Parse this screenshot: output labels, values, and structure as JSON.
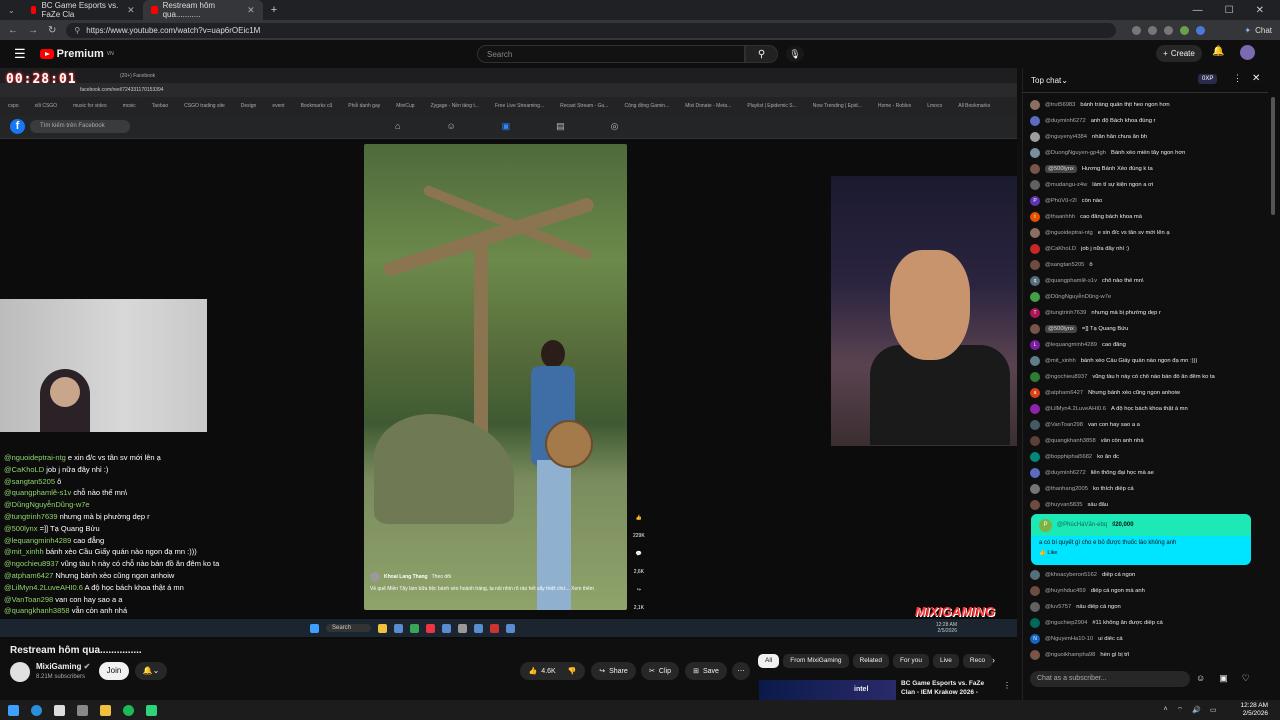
{
  "browser": {
    "tabs": [
      {
        "title": "BC Game Esports vs. FaZe Cla"
      },
      {
        "title": "Restream hôm qua..........."
      }
    ],
    "new_tab": "+",
    "url": "https://www.youtube.com/watch?v=uap6rOEic1M",
    "chat_button": "Chat"
  },
  "youtube": {
    "brand": "Premium",
    "region": "VN",
    "search_placeholder": "Search",
    "create_label": "Create"
  },
  "video": {
    "timer": "00:28:01",
    "inner_tab_fb": "(20+) Facebook",
    "inner_url": "facebook.com/reel/724331170153394",
    "bookmarks": [
      "cspo",
      "xổi CSGO",
      "music for video",
      "mosic",
      "Taobao",
      "CSGO trading site",
      "Design",
      "event",
      "Bookmarks cũ",
      "Phối danh gay",
      "MiniCup",
      "Zygage - Nền tảng t...",
      "Free Live Streaming...",
      "Recast Stream - Gu...",
      "Cộng đồng Gamin...",
      "Mixi Donate - Meta...",
      "Playlist | Epidemic S...",
      "Now Trending | Epid...",
      "Home - Roblox",
      "Lmoco",
      "All Bookmarks"
    ],
    "fb_search": "Tìm kiếm trên Facebook",
    "reel_author": "Khoai Lang Thang",
    "reel_follow": "Theo dõi",
    "reel_caption": "Về quê Miền Tây làm bữa tiệc bánh xèo hoành tráng, ta nói nhìn rõ ráo hết sẩy thiệt chứ... Xem thêm",
    "reel_likes": "229K",
    "reel_comments": "2,6K",
    "reel_shares": "2,1K",
    "overlay_chat": [
      {
        "user": "@nguoideptrai-ntg",
        "text": "e xin đ/c vs tân sv mới lên ạ"
      },
      {
        "user": "@CaKhoLD",
        "text": "job j nữa đây nhỉ :)"
      },
      {
        "user": "@sangtan5205",
        "text": "ô"
      },
      {
        "user": "@quangphamlê-s1v",
        "text": "chỗ nào thế mn\\"
      },
      {
        "user": "@DũngNguyễnDũng-w7e",
        "text": ""
      },
      {
        "user": "@tungtrinh7639",
        "text": "nhưng mà bị phường dẹp r"
      },
      {
        "user": "@500lynx",
        "text": "=]] Tạ Quang Bửu"
      },
      {
        "user": "@lequangminh4289",
        "text": "cao đẳng"
      },
      {
        "user": "@mit_xinhh",
        "text": "bánh xèo Cầu Giấy quán nào ngon đạ mn :)))"
      },
      {
        "user": "@ngochieu8937",
        "text": "vũng tàu h này có chỗ nào bán đồ ăn đêm ko ta"
      },
      {
        "user": "@atpham6427",
        "text": "Nhưng bánh xèo cũng ngon anhoiw"
      },
      {
        "user": "@LilMyn4.2LuveAHI0.6",
        "text": "A độ học bách khoa thật á mn"
      },
      {
        "user": "@VanToan298",
        "text": "van con hay sao a a"
      },
      {
        "user": "@quangkhanh3858",
        "text": "vẫn còn anh nhá"
      },
      {
        "user": "@bopphiphai5682",
        "text": "ko ăn đc"
      }
    ],
    "watermark": "MIXIGAMING",
    "taskbar_search": "Search",
    "taskbar_time": "12:28 AM",
    "taskbar_date": "2/5/2026",
    "title": "Restream hôm qua...............",
    "channel": "MixiGaming",
    "subscribers": "8.21M subscribers",
    "join": "Join",
    "likes": "4.6K",
    "share": "Share",
    "clip": "Clip",
    "save": "Save"
  },
  "chips": [
    "All",
    "From MixiGaming",
    "Related",
    "For you",
    "Live",
    "Reco"
  ],
  "recommended": {
    "title": "BC Game Esports vs. FaZe Clan - IEM Krakow 2026 -",
    "thumb_text": "intel"
  },
  "chat": {
    "header": "Top chat",
    "xp": "0XP",
    "messages": [
      {
        "user": "@trut56983",
        "text": "bánh tráng quấn thịt heo ngon hơn",
        "color": "#8d6e63",
        "initial": ""
      },
      {
        "user": "@duyminh6272",
        "text": "anh độ Bách khoa đúng r",
        "color": "#5c6bc0",
        "initial": ""
      },
      {
        "user": "@nguyenyi4384",
        "text": "nhắn hẳn chưa ăn bh",
        "color": "#9e9e9e",
        "initial": ""
      },
      {
        "user": "@DuongNguyen-gp4gh",
        "text": "Bánh xèo miền tây ngon hơn",
        "color": "#78909c",
        "initial": ""
      },
      {
        "user": "@500lynx",
        "text": "Hương Bánh Xèo đúng k ta",
        "color": "#795548",
        "initial": "",
        "mod": true
      },
      {
        "user": "@mudangu-z4w",
        "text": "làm tí sự kiện ngon a ơi",
        "color": "#616161",
        "initial": ""
      },
      {
        "user": "@PhúVũ-r2l",
        "text": "còn nào",
        "color": "#5e35b1",
        "initial": "P"
      },
      {
        "user": "@thaanhhh",
        "text": "cao đẳng bách khoa mà",
        "color": "#e65100",
        "initial": "t"
      },
      {
        "user": "@nguoideptrai-ntg",
        "text": "e xin đ/c vs tân sv mới lên ạ",
        "color": "#8d6e63",
        "initial": ""
      },
      {
        "user": "@CaKhoLD",
        "text": "job j nữa đây nhỉ :)",
        "color": "#c62828",
        "initial": ""
      },
      {
        "user": "@sangtan5205",
        "text": "ô",
        "color": "#6d4c41",
        "initial": ""
      },
      {
        "user": "@quangphamlê-s1v",
        "text": "chỗ nào thế mn\\",
        "color": "#546e7a",
        "initial": "q"
      },
      {
        "user": "@DũngNguyễnDũng-w7e",
        "text": "",
        "color": "#43a047",
        "initial": ""
      },
      {
        "user": "@tungtrinh7639",
        "text": "nhưng mà bị phường dẹp r",
        "color": "#ad1457",
        "initial": "T"
      },
      {
        "user": "@500lynx",
        "text": "=]] Tạ Quang Bửu",
        "color": "#795548",
        "initial": "",
        "mod": true
      },
      {
        "user": "@lequangminh4289",
        "text": "cao đẳng",
        "color": "#7b1fa2",
        "initial": "L"
      },
      {
        "user": "@mit_xinhh",
        "text": "bánh xèo Cầu Giấy quán nào ngon đạ mn :)))",
        "color": "#607d8b",
        "initial": ""
      },
      {
        "user": "@ngochieu8937",
        "text": "vũng tàu h này có chỗ nào bán đồ ăn đêm ko ta",
        "color": "#2e7d32",
        "initial": ""
      },
      {
        "user": "@atpham6427",
        "text": "Nhưng bánh xèo cũng ngon anhoiw",
        "color": "#d84315",
        "initial": "a"
      },
      {
        "user": "@LilMyn4.2LuveAHI0.6",
        "text": "A độ học bách khoa thật á mn",
        "color": "#8e24aa",
        "initial": ""
      },
      {
        "user": "@VanToan298",
        "text": "van con hay sao a a",
        "color": "#455a64",
        "initial": ""
      },
      {
        "user": "@quangkhanh3858",
        "text": "vẫn còn anh nhá",
        "color": "#5d4037",
        "initial": ""
      },
      {
        "user": "@bopphiphai5682",
        "text": "ko ăn đc",
        "color": "#00897b",
        "initial": ""
      },
      {
        "user": "@duyminh6272",
        "text": "liên thông đại học mà ae",
        "color": "#5c6bc0",
        "initial": ""
      },
      {
        "user": "@thanhang2005",
        "text": "ko thích diếp cá",
        "color": "#757575",
        "initial": ""
      },
      {
        "user": "@huyvan5835",
        "text": "sầu đâu",
        "color": "#6d4c41",
        "initial": ""
      }
    ],
    "superchat": {
      "initial": "P",
      "user": "@PhúcHaVăn-ebq",
      "amount": "₫20,000",
      "text": "a có bí quyết gì cho e bỏ được thuốc lào không anh",
      "like": "Like"
    },
    "messages2": [
      {
        "user": "@khoacyberon5162",
        "text": "diếp cá ngon",
        "color": "#546e7a",
        "initial": ""
      },
      {
        "user": "@huynhduc459",
        "text": "diếp cá ngon mà anh",
        "color": "#6d4c41",
        "initial": ""
      },
      {
        "user": "@luv5757",
        "text": "nấu diếp cá ngon",
        "color": "#616161",
        "initial": ""
      },
      {
        "user": "@nguchiep2904",
        "text": "#11 không ăn được diếp cá",
        "color": "#00695c",
        "initial": ""
      },
      {
        "user": "@NguyenHa10-10",
        "text": "ui diếc cá",
        "color": "#1565c0",
        "initial": "N"
      },
      {
        "user": "@nguoikhampha98",
        "text": "hèn gì bị trĩ",
        "color": "#795548",
        "initial": ""
      }
    ],
    "input_placeholder": "Chat as a subscriber..."
  },
  "os": {
    "time": "12:28 AM",
    "date": "2/5/2026"
  }
}
